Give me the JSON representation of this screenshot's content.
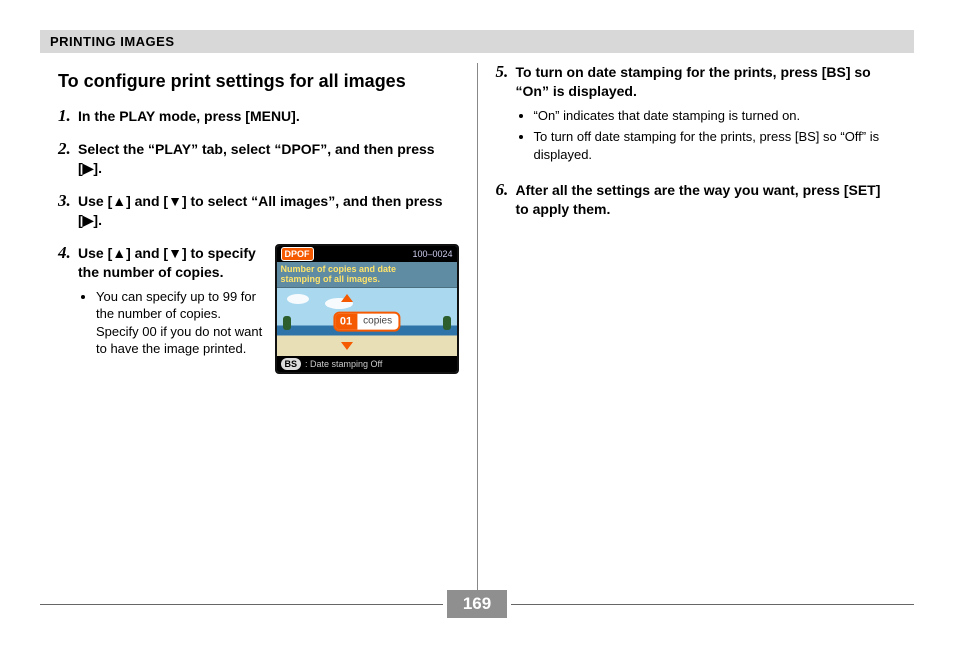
{
  "header": "PRINTING IMAGES",
  "title": "To configure print settings for all images",
  "steps_left": [
    {
      "n": "1.",
      "text": "In the PLAY mode, press [MENU]."
    },
    {
      "n": "2.",
      "text": "Select the “PLAY” tab, select “DPOF”, and then press [▶]."
    },
    {
      "n": "3.",
      "text": "Use [▲] and [▼] to select “All images”, and then press [▶]."
    }
  ],
  "step4": {
    "n": "4.",
    "text": "Use [▲] and [▼] to specify the number of copies.",
    "sub": [
      "You can specify up to 99 for the number of copies. Specify 00 if you do not want to have the image printed."
    ]
  },
  "steps_right": [
    {
      "n": "5.",
      "text": "To turn on date stamping for the prints, press [BS] so “On” is displayed.",
      "sub": [
        "“On” indicates that date stamping is turned on.",
        "To turn off date stamping for the prints, press [BS] so “Off” is displayed."
      ]
    },
    {
      "n": "6.",
      "text": "After all the settings are the way you want, press [SET] to apply them."
    }
  ],
  "lcd": {
    "dpof": "DPOF",
    "imgno": "100–0024",
    "desc1": "Number of copies and date",
    "desc2": "stamping of all images.",
    "copies_val": "01",
    "copies_lbl": "copies",
    "bs": "BS",
    "ds": ": Date stamping Off"
  },
  "page_number": "169"
}
